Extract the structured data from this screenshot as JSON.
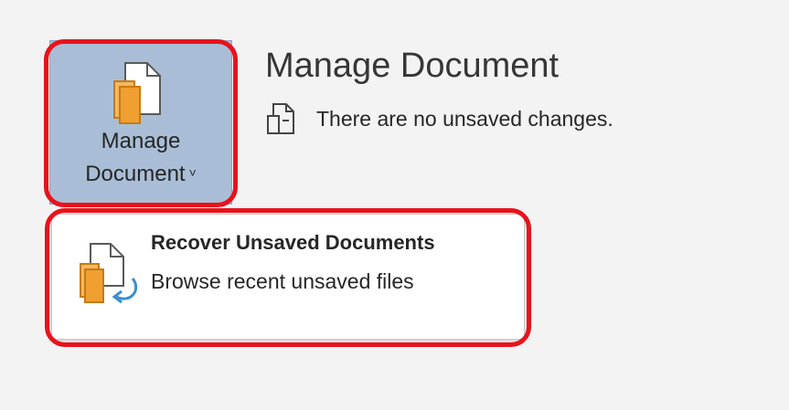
{
  "manage_button": {
    "label_line1": "Manage",
    "label_line2": "Document",
    "chevron": "˅",
    "icon": "documents-icon"
  },
  "section": {
    "title": "Manage Document",
    "status_icon": "document-status-icon",
    "status_text": "There are no unsaved changes."
  },
  "menu": {
    "items": [
      {
        "title": "Recover Unsaved Documents",
        "description": "Browse recent unsaved files",
        "icon": "recover-documents-icon"
      }
    ]
  },
  "colors": {
    "button_bg": "#a9bed6",
    "highlight": "#e8121c",
    "doc_orange": "#f0a030",
    "recover_arrow": "#3a8fd0"
  }
}
